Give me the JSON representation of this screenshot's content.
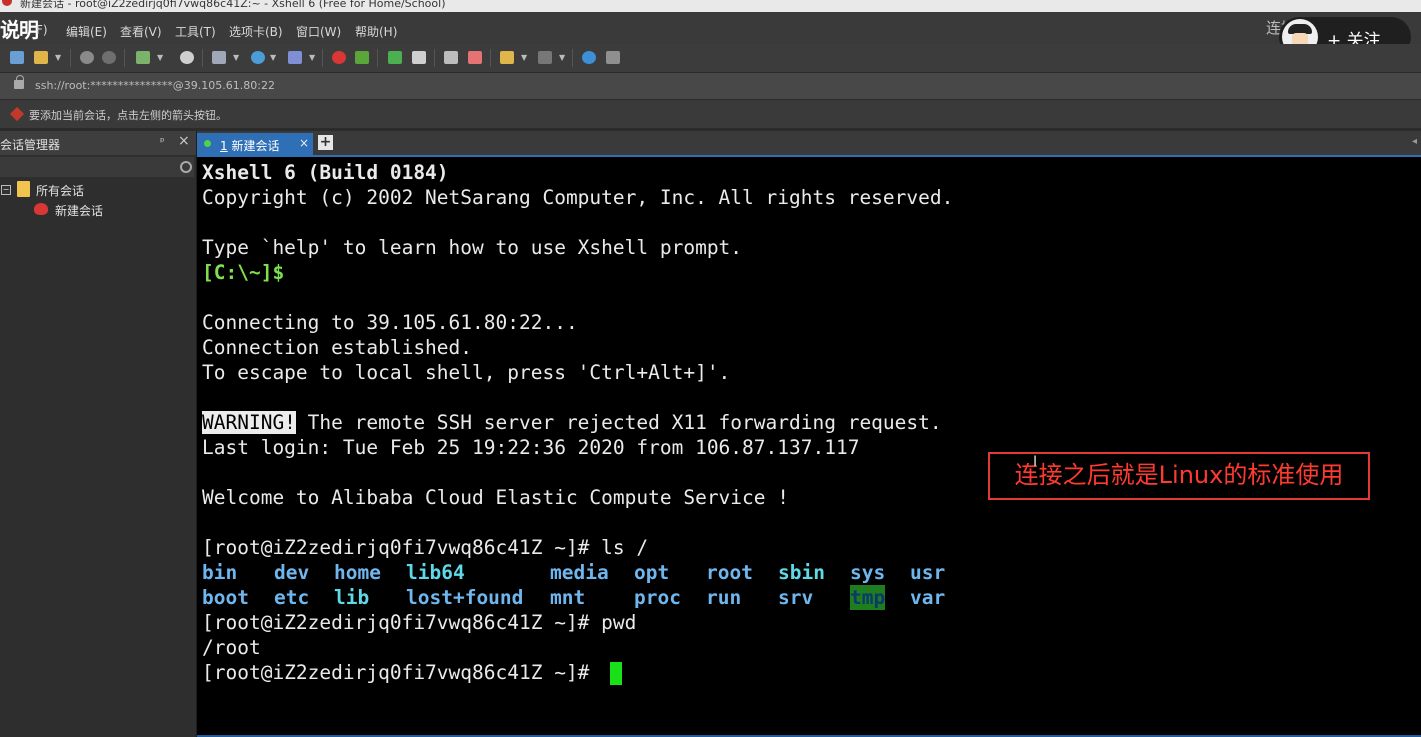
{
  "window": {
    "title": "新建会话 - root@iZ2zedirjq0fi7vwq86c41Z:~ - Xshell 6 (Free for Home/School)"
  },
  "menu": {
    "overlay_caption": "说明",
    "items": [
      "F)",
      "编辑(E)",
      "查看(V)",
      "工具(T)",
      "选项卡(B)",
      "窗口(W)",
      "帮助(H)"
    ]
  },
  "overlay": {
    "corner_text": "连接",
    "follow_label": "+ 关注"
  },
  "toolbar": {
    "icons": [
      "new-session-icon",
      "open-folder-icon",
      "connect-icon",
      "disconnect-icon",
      "new-tab-icon",
      "find-icon",
      "properties-icon",
      "globe-icon",
      "font-icon",
      "xftp-icon",
      "xagent-icon",
      "fullscreen-icon",
      "lock-icon",
      "keyboard-icon",
      "highlight-icon",
      "script-icon",
      "layout-icon",
      "help-icon",
      "chat-icon"
    ]
  },
  "address": {
    "value": "ssh://root:***************@39.105.61.80:22"
  },
  "hint": {
    "text": "要添加当前会话，点击左侧的箭头按钮。"
  },
  "session_manager": {
    "title": "会话管理器",
    "pin": "ᵖ",
    "close": "×",
    "tree": {
      "root_label": "所有会话",
      "child_label": "新建会话",
      "toggle": "−"
    }
  },
  "tabs": [
    {
      "number": "1",
      "label": "新建会话",
      "close": "×"
    }
  ],
  "tab_add": "+",
  "terminal": {
    "lines": {
      "l1": "Xshell 6 (Build 0184)",
      "l2": "Copyright (c) 2002 NetSarang Computer, Inc. All rights reserved.",
      "l3": "Type `help' to learn how to use Xshell prompt.",
      "l4": "[C:\\~]$",
      "l5": "Connecting to 39.105.61.80:22...",
      "l6": "Connection established.",
      "l7": "To escape to local shell, press 'Ctrl+Alt+]'.",
      "l8_warn": "WARNING!",
      "l8_rest": " The remote SSH server rejected X11 forwarding request.",
      "l9": "Last login: Tue Feb 25 19:22:36 2020 from 106.87.137.117",
      "l10": "Welcome to Alibaba Cloud Elastic Compute Service !",
      "l11": "[root@iZ2zedirjq0fi7vwq86c41Z ~]# ls /",
      "l12": "[root@iZ2zedirjq0fi7vwq86c41Z ~]# pwd",
      "l13": "/root",
      "l14": "[root@iZ2zedirjq0fi7vwq86c41Z ~]# "
    },
    "dirs_row1": [
      "bin",
      "dev",
      "home",
      "lib64",
      "media",
      "opt",
      "root",
      "sbin",
      "sys",
      "usr"
    ],
    "dirs_row2": [
      "boot",
      "etc",
      "lib",
      "lost+found",
      "mnt",
      "proc",
      "run",
      "srv",
      "tmp",
      "var"
    ],
    "colors": {
      "dir": "#6fb6ee",
      "link": "#5fd8e8",
      "prompt": "#7ee050",
      "cursor": "#19e019",
      "tmp_bg": "#1e7d1e"
    }
  },
  "annotation": {
    "text": "连接之后就是Linux的标准使用",
    "color": "#e53935"
  }
}
